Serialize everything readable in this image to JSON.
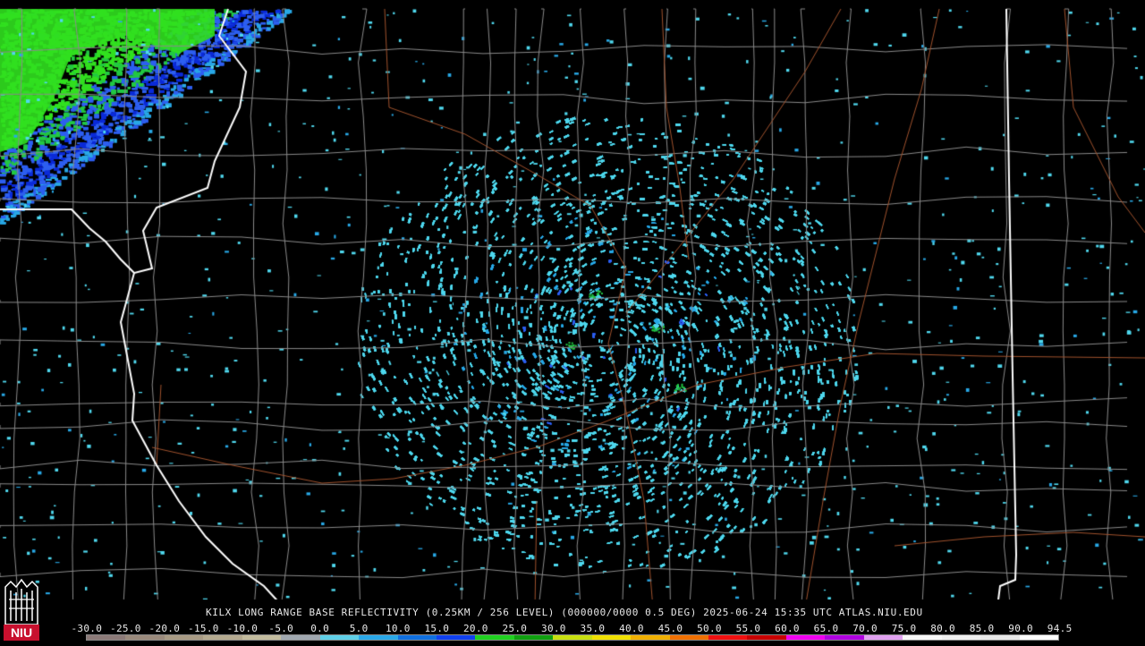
{
  "product": {
    "caption": "KILX LONG RANGE BASE REFLECTIVITY (0.25KM / 256 LEVEL) (000000/0000 0.5 DEG) 2025-06-24 15:35 UTC  ATLAS.NIU.EDU"
  },
  "logo": {
    "text": "NIU",
    "color": "#c8102e"
  },
  "colorbar": {
    "tick_labels": [
      "-30.0",
      "-25.0",
      "-20.0",
      "-15.0",
      "-10.0",
      "-5.0",
      "0.0",
      "5.0",
      "10.0",
      "15.0",
      "20.0",
      "25.0",
      "30.0",
      "35.0",
      "40.0",
      "45.0",
      "50.0",
      "55.0",
      "60.0",
      "65.0",
      "70.0",
      "75.0",
      "80.0",
      "85.0",
      "90.0",
      "94.5"
    ],
    "colors": [
      "#8c7a78",
      "#9a8a7c",
      "#a89a84",
      "#b5aa90",
      "#c3bc9e",
      "#a0a8b0",
      "#5fd0e8",
      "#2aa8e8",
      "#1070e0",
      "#1040f0",
      "#20d020",
      "#10a010",
      "#c8e010",
      "#f0e000",
      "#f0b000",
      "#f07000",
      "#f01010",
      "#c80000",
      "#f000f0",
      "#b000e0",
      "#e0a0f0",
      "#f8f8f8",
      "#f0f0f0",
      "#e8e8e8",
      "#ffffff"
    ],
    "range_dbz": [
      -30.0,
      94.5
    ]
  },
  "radar": {
    "site": "KILX",
    "colors": {
      "light": "#4fd8ee",
      "medium": "#28a8e6",
      "blue": "#2d5ff0",
      "green": "#22c842",
      "bright_green": "#31e01f",
      "dark_blue": "#0a2ad8"
    }
  },
  "map_colors": {
    "county": "#8a8a8a",
    "state": "#ffffff",
    "road": "#a0522d"
  }
}
